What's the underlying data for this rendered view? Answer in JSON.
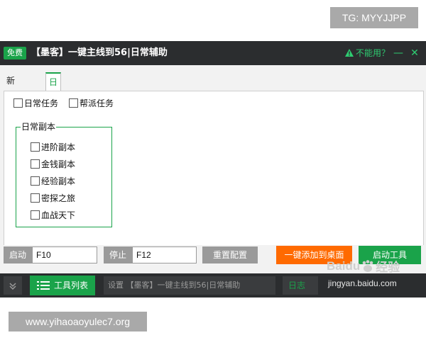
{
  "watermark_tg": "TG: MYYJJPP",
  "watermark_site": "www.yihaoaoyulec7.org",
  "titlebar": {
    "badge": "免费",
    "title": "【墨客】一键主线到56|日常辅助",
    "warning": "不能用？",
    "minimize": "—",
    "close": "✕"
  },
  "tabs": [
    {
      "label": "新号推荐",
      "active": false
    },
    {
      "label": "日常辅助",
      "active": true
    }
  ],
  "daily_options": [
    {
      "label": "日常任务",
      "checked": false
    },
    {
      "label": "帮派任务",
      "checked": false
    }
  ],
  "dungeon_group": {
    "title": "日常副本",
    "items": [
      {
        "label": "进阶副本",
        "checked": false
      },
      {
        "label": "金钱副本",
        "checked": false
      },
      {
        "label": "经验副本",
        "checked": false
      },
      {
        "label": "密探之旅",
        "checked": false
      },
      {
        "label": "血战天下",
        "checked": false
      }
    ]
  },
  "controls": {
    "start_label": "启动",
    "start_key": "F10",
    "stop_label": "停止",
    "stop_key": "F12",
    "reset_label": "重置配置",
    "add_desktop_label": "一键添加到桌面",
    "launch_label": "启动工具"
  },
  "footer": {
    "tools_label": "工具列表",
    "status_text": "设置 【墨客】一键主线到56|日常辅助",
    "log_label": "日志"
  },
  "baidu_watermark": {
    "brand": "Baidu",
    "suffix": "经验",
    "url": "jingyan.baidu.com"
  },
  "colors": {
    "accent_green": "#1aa34a",
    "accent_orange": "#ff6a00",
    "titlebar_bg": "#2b2d2f"
  }
}
